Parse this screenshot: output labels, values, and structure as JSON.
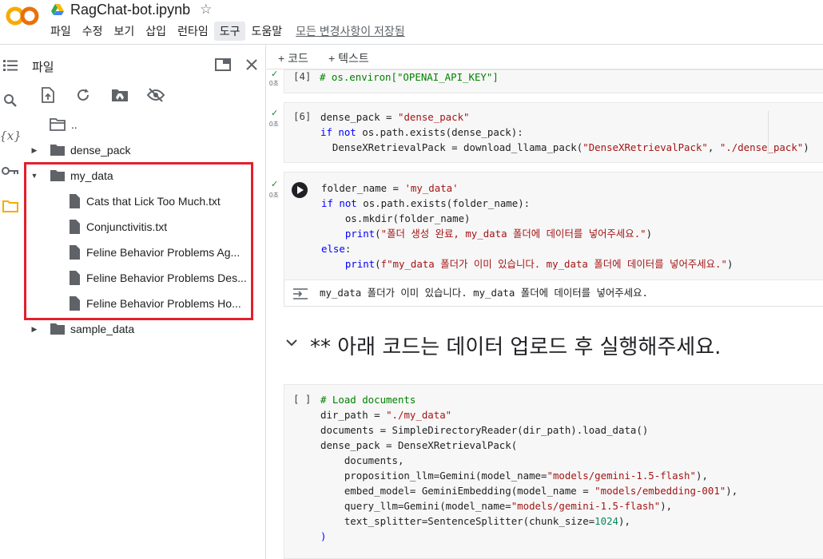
{
  "app": {
    "logo_text": "CO",
    "title": "RagChat-bot.ipynb",
    "menu": [
      "파일",
      "수정",
      "보기",
      "삽입",
      "런타임",
      "도구",
      "도움말"
    ],
    "active_menu_index": 5,
    "save_status": "모든 변경사항이 저장됨"
  },
  "files_panel": {
    "title": "파일",
    "tree": [
      {
        "label": "..",
        "type": "parent"
      },
      {
        "label": "dense_pack",
        "type": "folder",
        "expanded": false
      },
      {
        "label": "my_data",
        "type": "folder",
        "expanded": true
      },
      {
        "label": "Cats that Lick Too Much.txt",
        "type": "file"
      },
      {
        "label": "Conjunctivitis.txt",
        "type": "file"
      },
      {
        "label": "Feline Behavior Problems Ag...",
        "type": "file"
      },
      {
        "label": "Feline Behavior Problems Des...",
        "type": "file"
      },
      {
        "label": "Feline Behavior Problems Ho...",
        "type": "file"
      },
      {
        "label": "sample_data",
        "type": "folder",
        "expanded": false
      }
    ]
  },
  "notebook": {
    "toolbar": {
      "add_code": "+ 코드",
      "add_text": "+ 텍스트"
    },
    "cells": [
      {
        "prompt": "[4]",
        "time": "0초",
        "code": "# os.environ[\"OPENAI_API_KEY\"]"
      },
      {
        "prompt": "[6]",
        "time": "0초",
        "code_lines": [
          "dense_pack = \"dense_pack\"",
          "if not os.path.exists(dense_pack):",
          "  DenseXRetrievalPack = download_llama_pack(\"DenseXRetrievalPack\", \"./dense_pack\")"
        ]
      },
      {
        "prompt": "",
        "time": "0초",
        "code_lines": [
          "folder_name = 'my_data'",
          "if not os.path.exists(folder_name):",
          "    os.mkdir(folder_name)",
          "    print(\"폴더 생성 완료, my_data 폴더에 데이터를 넣어주세요.\")",
          "else:",
          "    print(f\"my_data 폴더가 이미 있습니다. my_data 폴더에 데이터를 넣어주세요.\")"
        ],
        "output": "my_data 폴더가 이미 있습니다. my_data 폴더에 데이터를 넣어주세요."
      },
      {
        "type": "markdown",
        "heading": "** 아래 코드는 데이터 업로드 후 실행해주세요."
      },
      {
        "prompt": "[ ]",
        "code_lines": [
          "# Load documents",
          "dir_path = \"./my_data\"",
          "documents = SimpleDirectoryReader(dir_path).load_data()",
          "dense_pack = DenseXRetrievalPack(",
          "    documents,",
          "    proposition_llm=Gemini(model_name=\"models/gemini-1.5-flash\"),",
          "    embed_model= GeminiEmbedding(model_name = \"models/embedding-001\"),",
          "    query_llm=Gemini(model_name=\"models/gemini-1.5-flash\"),",
          "    text_splitter=SentenceSplitter(chunk_size=1024),",
          ")"
        ]
      }
    ]
  },
  "colors": {
    "accent_orange": "#f9ab00",
    "highlight_red": "#e3202d",
    "string_red": "#a31515",
    "keyword_blue": "#0000ff",
    "comment_green": "#008000"
  }
}
